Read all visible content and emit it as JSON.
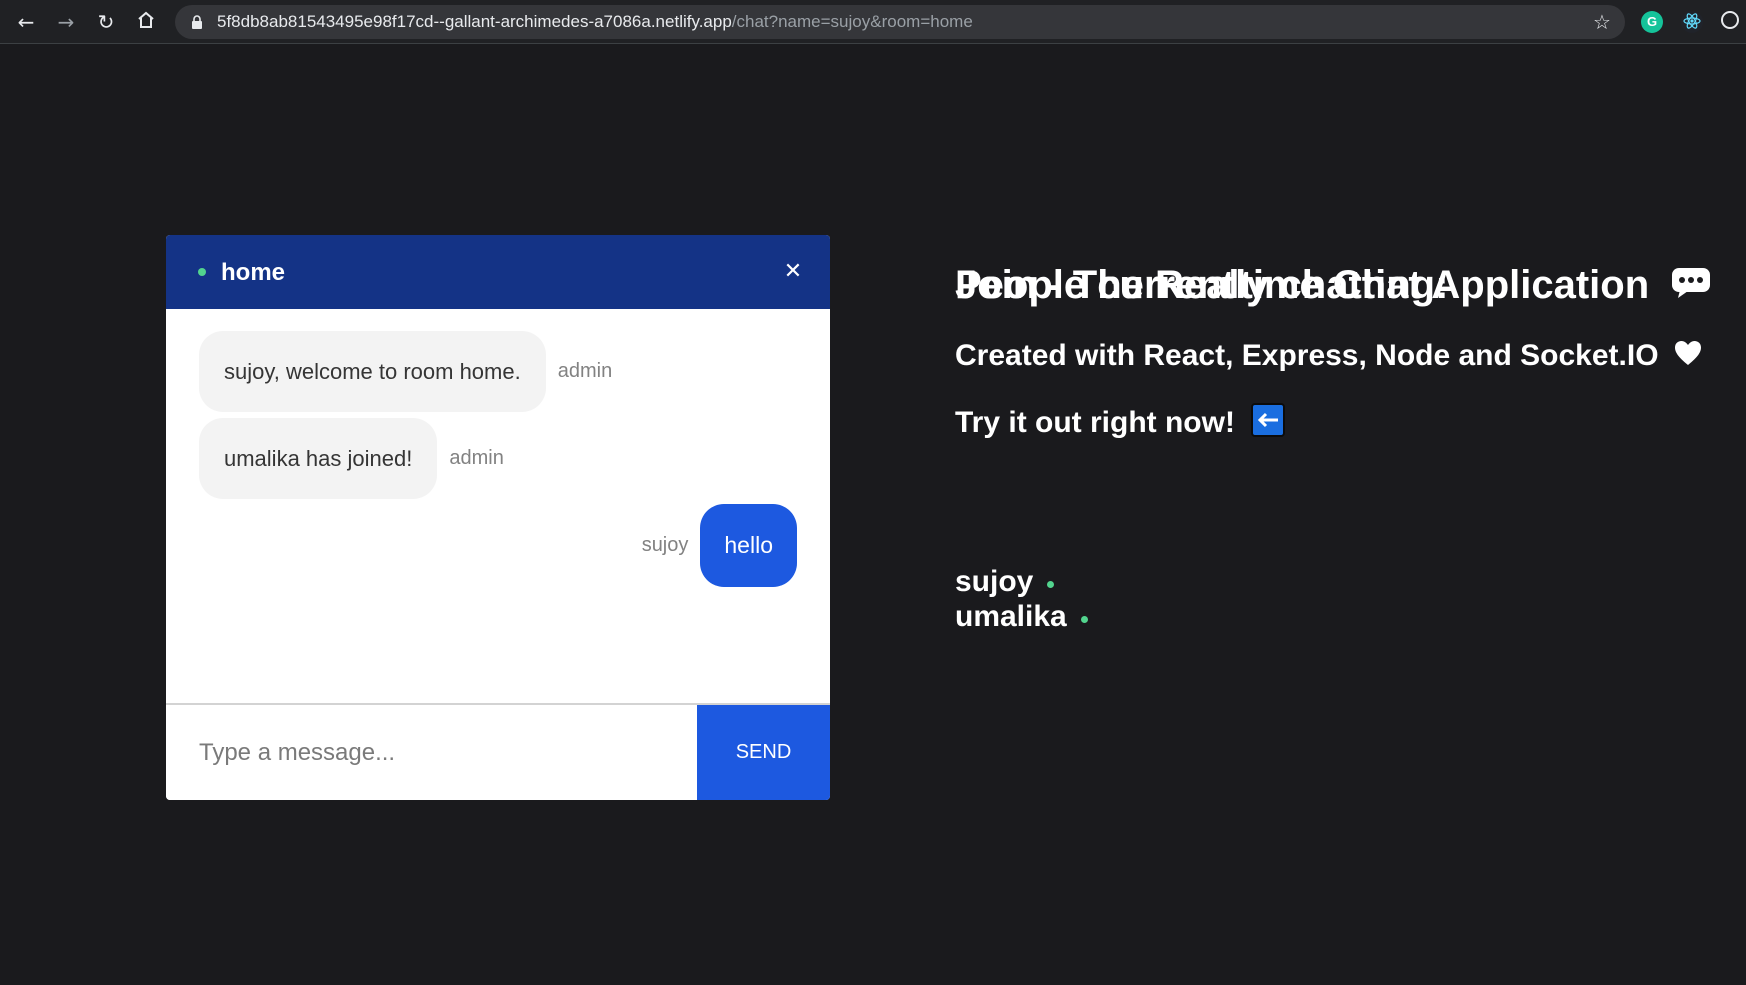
{
  "browser": {
    "url_host": "5f8db8ab81543495e98f17cd--gallant-archimedes-a7086a.netlify.app",
    "url_path": "/chat?name=sujoy&room=home",
    "nav_icons": [
      "back-icon",
      "forward-icon",
      "reload-icon",
      "home-icon"
    ],
    "extension_icons": [
      "grammarly-icon",
      "react-devtools-icon",
      "profile-icon"
    ],
    "extension_grammarly_letter": "G"
  },
  "chat": {
    "room_name": "home",
    "close_symbol": "✕",
    "messages": [
      {
        "text": "sujoy, welcome to room home.",
        "sender": "admin",
        "side": "left"
      },
      {
        "text": "umalika has joined!",
        "sender": "admin",
        "side": "left"
      },
      {
        "text": "hello",
        "sender": "sujoy",
        "side": "right"
      }
    ],
    "input_placeholder": "Type a message...",
    "send_label": "SEND"
  },
  "info": {
    "title": "Join - The Realtime Chat Application",
    "subtitle": "Created with React, Express, Node and Socket.IO",
    "cta": "Try it out right now!",
    "people_title": "People currently chatting:",
    "people": [
      "sujoy",
      "umalika"
    ]
  },
  "colors": {
    "background": "#1a1a1d",
    "header": "#143386",
    "accent": "#1d59e0",
    "online": "#52d48e"
  }
}
